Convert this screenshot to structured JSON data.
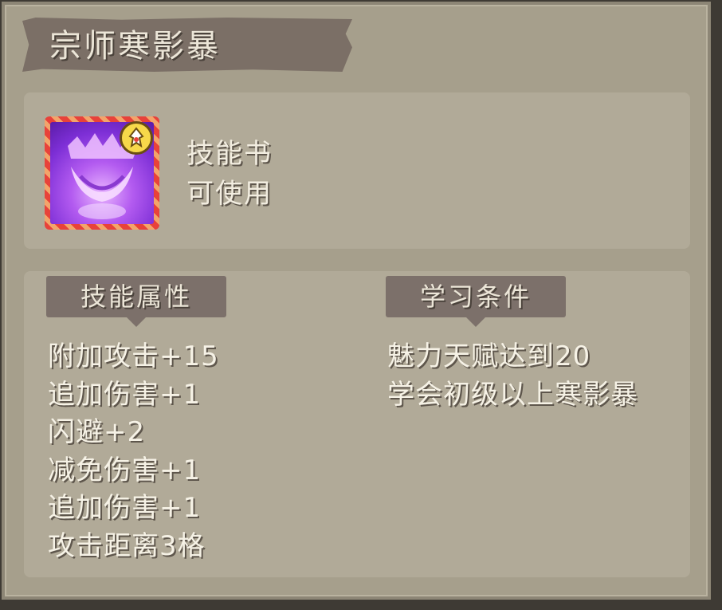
{
  "title": "宗师寒影暴",
  "item": {
    "type": "技能书",
    "status": "可使用",
    "icon": "purple-grin-mask-icon",
    "badge_icon": "flame-badge-icon",
    "frame_color": "#e8423a"
  },
  "attributes": {
    "header": "技能属性",
    "items": [
      "附加攻击+15",
      "追加伤害+1",
      "闪避+2",
      "减免伤害+1",
      "追加伤害+1",
      "攻击距离3格"
    ]
  },
  "requirements": {
    "header": "学习条件",
    "items": [
      "魅力天赋达到20",
      "学会初级以上寒影暴"
    ]
  }
}
